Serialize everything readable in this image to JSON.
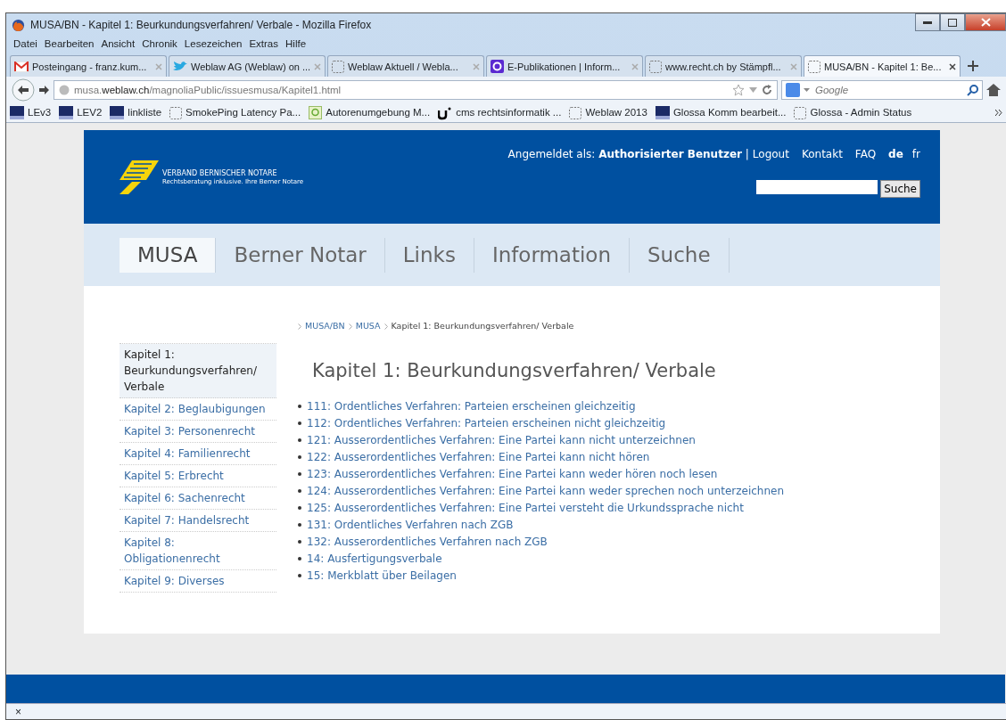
{
  "window": {
    "title": "MUSA/BN - Kapitel 1: Beurkundungsverfahren/ Verbale - Mozilla Firefox"
  },
  "menu": [
    "Datei",
    "Bearbeiten",
    "Ansicht",
    "Chronik",
    "Lesezeichen",
    "Extras",
    "Hilfe"
  ],
  "tabs": [
    {
      "label": "Posteingang - franz.kum...",
      "kind": "mail",
      "selected": false
    },
    {
      "label": "Weblaw AG (Weblaw) on ...",
      "kind": "bird",
      "selected": false
    },
    {
      "label": "Weblaw Aktuell / Webla...",
      "kind": "blank",
      "selected": false
    },
    {
      "label": "E-Publikationen | Inform...",
      "kind": "letter",
      "selected": false
    },
    {
      "label": "www.recht.ch by Stämpfl...",
      "kind": "blank",
      "selected": false
    },
    {
      "label": "MUSA/BN - Kapitel 1: Be...",
      "kind": "blank",
      "selected": true
    }
  ],
  "address": {
    "prefix": "musa.",
    "domain": "weblaw.ch",
    "path": "/magnoliaPublic/issuesmusa/Kapitel1.html"
  },
  "search": {
    "placeholder": "Google"
  },
  "bookmarks": [
    {
      "label": "LEv3",
      "kind": "square"
    },
    {
      "label": "LEV2",
      "kind": "square"
    },
    {
      "label": "linkliste",
      "kind": "square"
    },
    {
      "label": "SmokePing Latency Pa...",
      "kind": "blank"
    },
    {
      "label": "Autorenumgebung M...",
      "kind": "green"
    },
    {
      "label": "cms rechtsinformatik ...",
      "kind": "u"
    },
    {
      "label": "Weblaw 2013",
      "kind": "blank"
    },
    {
      "label": "Glossa Komm bearbeit...",
      "kind": "square"
    },
    {
      "label": "Glossa - Admin Status",
      "kind": "blank"
    }
  ],
  "site": {
    "logo_name": "VERBAND BERNISCHER NOTARE",
    "logo_tagline": "Rechtsberatung inklusive. Ihre Berner Notare",
    "login_text": "Angemeldet als:",
    "user": "Authorisierter Benutzer",
    "separator": "|",
    "top_links": [
      "Logout",
      "Kontakt",
      "FAQ"
    ],
    "languages": [
      {
        "label": "de",
        "selected": true
      },
      {
        "label": "fr",
        "selected": false
      }
    ],
    "search_button": "Suche"
  },
  "nav": [
    {
      "label": "MUSA",
      "selected": true
    },
    {
      "label": "Berner Notar",
      "selected": false
    },
    {
      "label": "Links",
      "selected": false
    },
    {
      "label": "Information",
      "selected": false
    },
    {
      "label": "Suche",
      "selected": false
    }
  ],
  "sidebar": [
    {
      "label": "Kapitel 1: Beurkundungsverfahren/ Verbale",
      "selected": true
    },
    {
      "label": "Kapitel 2: Beglaubigungen",
      "selected": false
    },
    {
      "label": "Kapitel 3: Personenrecht",
      "selected": false
    },
    {
      "label": "Kapitel 4: Familienrecht",
      "selected": false
    },
    {
      "label": "Kapitel 5: Erbrecht",
      "selected": false
    },
    {
      "label": "Kapitel 6: Sachenrecht",
      "selected": false
    },
    {
      "label": "Kapitel 7: Handelsrecht",
      "selected": false
    },
    {
      "label": "Kapitel 8: Obligationenrecht",
      "selected": false
    },
    {
      "label": "Kapitel 9: Diverses",
      "selected": false
    }
  ],
  "breadcrumb": [
    {
      "label": "MUSA/BN",
      "kind": "link"
    },
    {
      "label": "MUSA",
      "kind": "link"
    },
    {
      "label": "Kapitel 1: Beurkundungsverfahren/ Verbale",
      "kind": "current"
    }
  ],
  "heading": "Kapitel 1: Beurkundungsverfahren/ Verbale",
  "links": [
    "111: Ordentliches Verfahren: Parteien erscheinen gleichzeitig",
    "112: Ordentliches Verfahren: Parteien erscheinen nicht gleichzeitig",
    "121: Ausserordentliches Verfahren: Eine Partei kann nicht unterzeichnen",
    "122: Ausserordentliches Verfahren: Eine Partei kann nicht hören",
    "123: Ausserordentliches Verfahren: Eine Partei kann weder hören noch lesen",
    "124: Ausserordentliches Verfahren: Eine Partei kann weder sprechen noch unterzeichnen",
    "125: Ausserordentliches Verfahren: Eine Partei versteht die Urkundssprache nicht",
    "131: Ordentliches Verfahren nach ZGB",
    "132: Ausserordentliches Verfahren nach ZGB",
    "14: Ausfertigungsverbale",
    "15: Merkblatt über Beilagen"
  ],
  "status_bar": {
    "close": "×"
  }
}
